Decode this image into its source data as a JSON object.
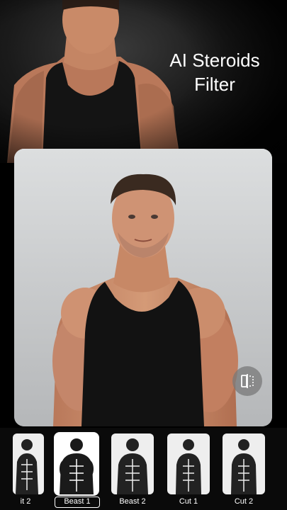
{
  "hero": {
    "title_line1": "AI Steroids",
    "title_line2": "Filter"
  },
  "photo": {
    "subject": "muscular man in black tank top"
  },
  "compare_button": {
    "icon": "compare-split-icon"
  },
  "filters": [
    {
      "label": "it 2"
    },
    {
      "label": "Beast 1",
      "selected": true
    },
    {
      "label": "Beast 2"
    },
    {
      "label": "Cut 1"
    },
    {
      "label": "Cut 2"
    }
  ],
  "colors": {
    "background": "#000000",
    "text": "#ffffff",
    "tank_top": "#111111",
    "skin": "#c98a63"
  }
}
